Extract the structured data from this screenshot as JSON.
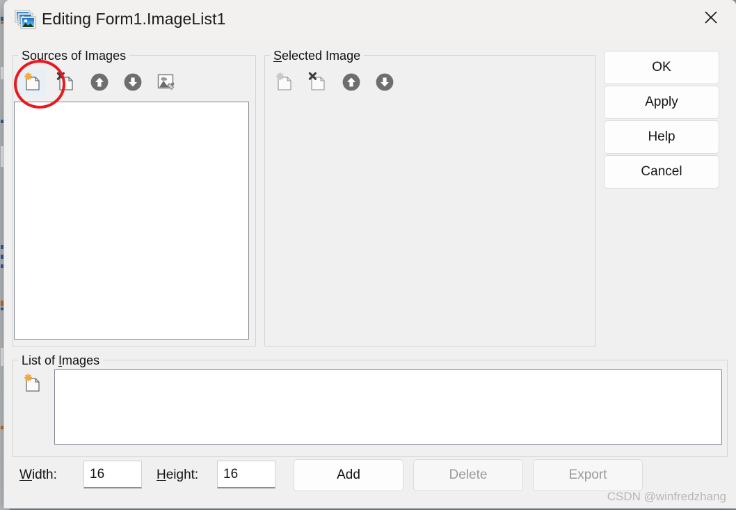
{
  "window": {
    "title": "Editing Form1.ImageList1",
    "icon": "image-list-icon",
    "close_label": "×"
  },
  "sources_group": {
    "title_prefix": "S",
    "title_rest": "ources of Images",
    "title_full": "Sources of Images",
    "toolbar": [
      {
        "name": "add-source-image",
        "icon": "new-file-icon",
        "enabled": true,
        "hovered": true
      },
      {
        "name": "delete-source-image",
        "icon": "delete-file-icon",
        "enabled": true,
        "hovered": false
      },
      {
        "name": "move-source-up",
        "icon": "arrow-up-circle-icon",
        "enabled": true,
        "hovered": false
      },
      {
        "name": "move-source-down",
        "icon": "arrow-down-circle-icon",
        "enabled": true,
        "hovered": false
      },
      {
        "name": "edit-source-image",
        "icon": "picture-edit-icon",
        "enabled": true,
        "hovered": false
      }
    ],
    "list_items": []
  },
  "selected_group": {
    "title_prefix": "S",
    "title_rest": "elected Image",
    "title_full": "Selected Image",
    "toolbar": [
      {
        "name": "add-selected-image",
        "icon": "new-file-icon",
        "enabled": false,
        "hovered": false
      },
      {
        "name": "delete-selected-image",
        "icon": "delete-file-icon",
        "enabled": false,
        "hovered": false
      },
      {
        "name": "move-selected-up",
        "icon": "arrow-up-circle-icon",
        "enabled": true,
        "hovered": false
      },
      {
        "name": "move-selected-down",
        "icon": "arrow-down-circle-icon",
        "enabled": true,
        "hovered": false
      }
    ],
    "preview_items": []
  },
  "list_group": {
    "title_prefix_a": "List of ",
    "title_accel": "I",
    "title_rest": "mages",
    "title_full": "List of Images",
    "toolbar": [
      {
        "name": "add-list-image",
        "icon": "new-file-icon",
        "enabled": true,
        "hovered": false
      }
    ],
    "list_items": []
  },
  "command_buttons": [
    {
      "name": "ok-button",
      "label": "OK",
      "enabled": true
    },
    {
      "name": "apply-button",
      "label": "Apply",
      "enabled": true
    },
    {
      "name": "help-button",
      "label": "Help",
      "enabled": true
    },
    {
      "name": "cancel-button",
      "label": "Cancel",
      "enabled": true
    }
  ],
  "bottom_bar": {
    "width_label_accel": "W",
    "width_label_rest": "idth:",
    "width_label_full": "Width:",
    "width_value": "16",
    "height_label_accel": "H",
    "height_label_rest": "eight:",
    "height_label_full": "Height:",
    "height_value": "16",
    "buttons": [
      {
        "name": "add-button",
        "label": "Add",
        "enabled": true
      },
      {
        "name": "delete-button",
        "label": "Delete",
        "enabled": false
      },
      {
        "name": "export-button",
        "label": "Export",
        "enabled": false
      }
    ]
  },
  "annotation": {
    "shape": "ellipse",
    "color": "#e8191f",
    "targets": "add-source-image"
  },
  "watermark": {
    "text": "CSDN @winfredzhang"
  },
  "colors": {
    "dialog_background": "#f0f0f0",
    "titlebar_background": "#f3f1ef",
    "listbox_background": "#ffffff",
    "listbox_border": "#828790",
    "group_border": "#d3d3d3",
    "accent_orange": "#f0a840",
    "annotation_red": "#e8191f",
    "disabled_text": "#9a9a9a"
  }
}
